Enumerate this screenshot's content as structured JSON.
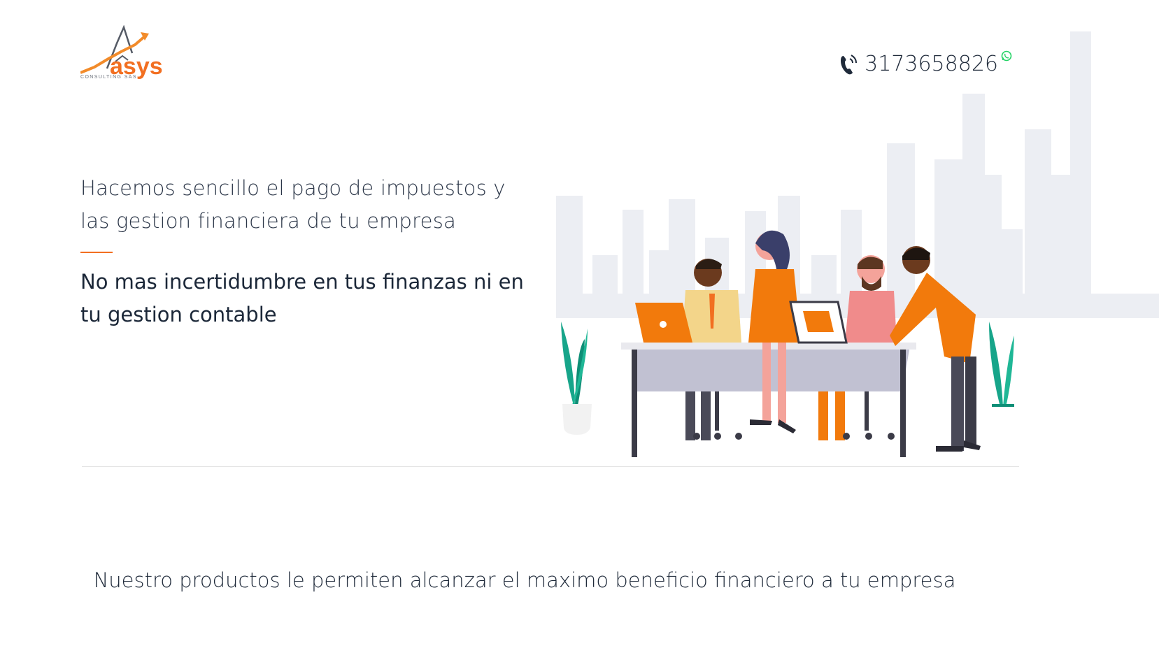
{
  "header": {
    "logo_text": "asys",
    "logo_tagline": "CONSULTING SAS",
    "phone_number": "3173658826"
  },
  "hero": {
    "subtitle": "Hacemos sencillo el pago de impuestos y las gestion financiera de tu empresa",
    "title": "No mas incertidumbre en tus finanzas ni en tu gestion contable"
  },
  "products": {
    "heading": "Nuestro productos le permiten alcanzar el maximo beneficio financiero a tu empresa"
  },
  "colors": {
    "accent": "#f26f21",
    "text": "#1f2a3a",
    "whatsapp": "#25d366"
  },
  "icons": {
    "phone": "phone-ringing-icon",
    "whatsapp": "whatsapp-icon"
  }
}
